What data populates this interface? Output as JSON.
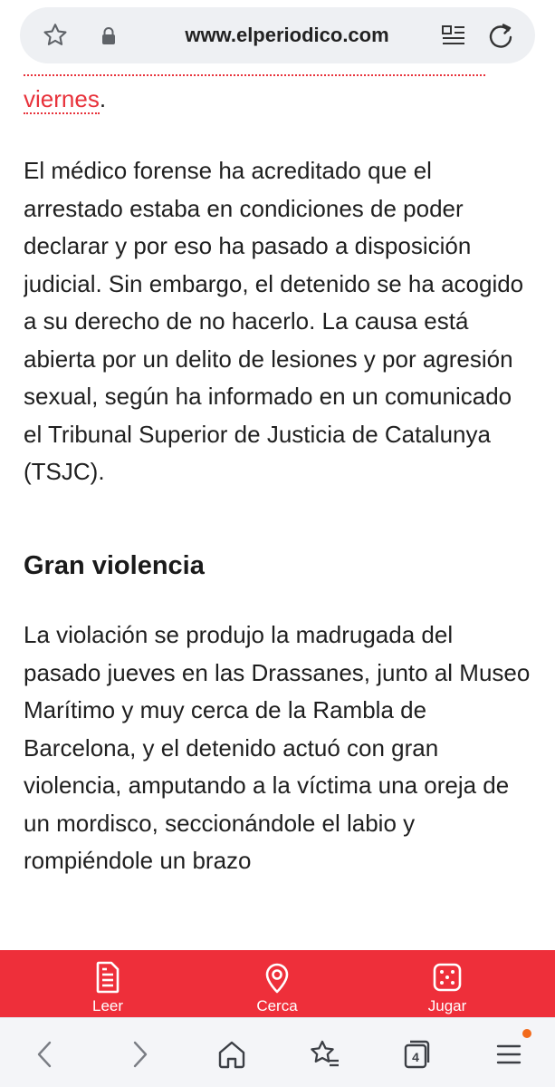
{
  "browser": {
    "url": "www.elperiodico.com",
    "tab_count": "4"
  },
  "article": {
    "link_text": "viernes",
    "link_trail": ".",
    "paragraph1": "El médico forense ha acreditado que el arrestado estaba en condiciones de poder declarar y por eso ha pasado a disposición judicial. Sin embargo, el detenido se ha acogido a su derecho de no hacerlo. La causa está abierta por un delito de lesiones y por agresión sexual, según ha informado en un comunicado el Tribunal Superior de Justicia de Catalunya (TSJC).",
    "heading": "Gran violencia",
    "paragraph2": "La violación se produjo la madrugada del pasado jueves en las Drassanes, junto al Museo Marítimo y muy cerca de la Rambla de Barcelona, y el detenido actuó con gran violencia, amputando a la víctima una oreja de un mordisco, seccionándole el labio y rompiéndole un brazo"
  },
  "site_nav": {
    "items": [
      {
        "label": "Leer",
        "icon": "document-icon"
      },
      {
        "label": "Cerca",
        "icon": "location-pin-icon"
      },
      {
        "label": "Jugar",
        "icon": "dice-icon"
      }
    ]
  },
  "colors": {
    "brand_red": "#ee2f3a",
    "link_red": "#e8323b",
    "notification_dot": "#f26a1b"
  }
}
